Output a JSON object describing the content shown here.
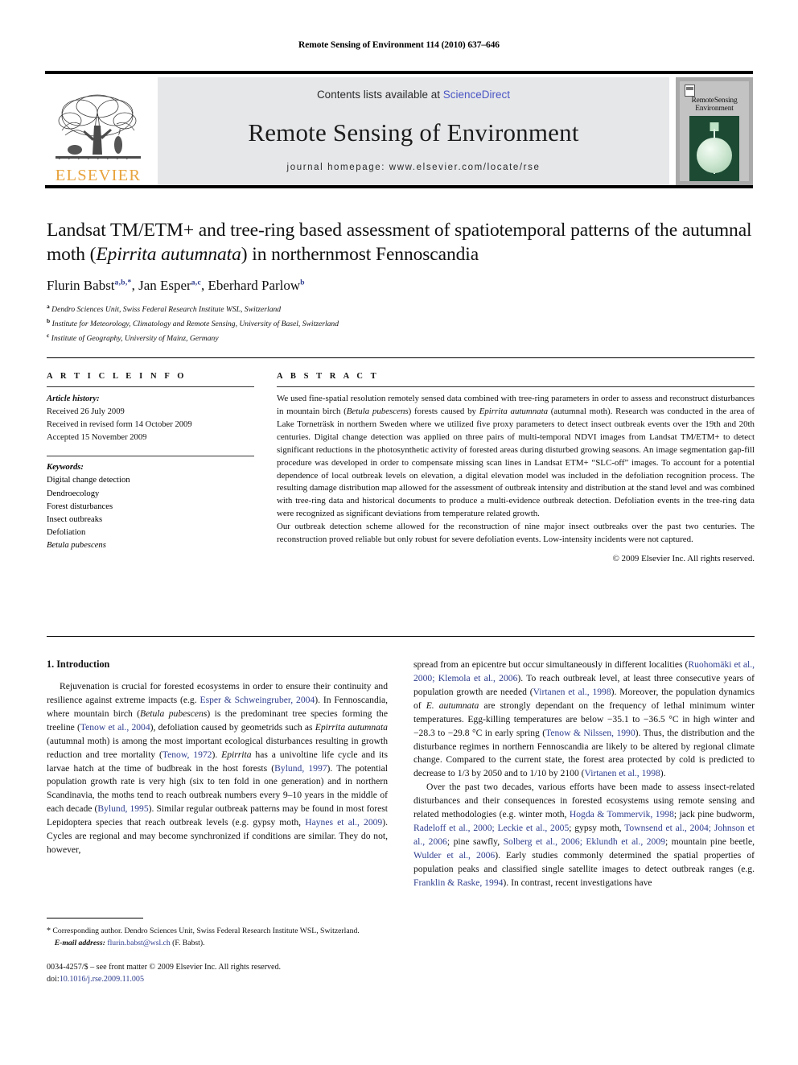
{
  "running_head": "Remote Sensing of Environment 114 (2010) 637–646",
  "masthead": {
    "contents_prefix": "Contents lists available at ",
    "sciencedirect_link": "ScienceDirect",
    "journal_title": "Remote Sensing of Environment",
    "homepage_line": "journal homepage: www.elsevier.com/locate/rse",
    "publisher_wordmark": "ELSEVIER",
    "cover_title_line1": "RemoteSensing",
    "cover_title_line2": "Environment"
  },
  "title": {
    "line1": "Landsat TM/ETM+ and tree-ring based assessment of spatiotemporal patterns of the",
    "line2_pre": "autumnal moth (",
    "line2_italic": "Epirrita autumnata",
    "line2_post": ") in northernmost Fennoscandia",
    "full": "Landsat TM/ETM+ and tree-ring based assessment of spatiotemporal patterns of the autumnal moth (Epirrita autumnata) in northernmost Fennoscandia"
  },
  "authors": {
    "a1_name": "Flurin Babst",
    "a1_sup": "a,b,*",
    "a2_name": "Jan Esper",
    "a2_sup": "a,c",
    "a3_name": "Eberhard Parlow",
    "a3_sup": "b",
    "affiliations": [
      {
        "mark": "a",
        "text": "Dendro Sciences Unit, Swiss Federal Research Institute WSL, Switzerland"
      },
      {
        "mark": "b",
        "text": "Institute for Meteorology, Climatology and Remote Sensing, University of Basel, Switzerland"
      },
      {
        "mark": "c",
        "text": "Institute of Geography, University of Mainz, Germany"
      }
    ]
  },
  "article_info": {
    "heading": "A R T I C L E    I N F O",
    "history_label": "Article history:",
    "history": [
      "Received 26 July 2009",
      "Received in revised form 14 October 2009",
      "Accepted 15 November 2009"
    ],
    "keywords_label": "Keywords:",
    "keywords": [
      "Digital change detection",
      "Dendroecology",
      "Forest disturbances",
      "Insect outbreaks",
      "Defoliation"
    ],
    "keyword_italic": "Betula pubescens"
  },
  "abstract": {
    "heading": "A B S T R A C T",
    "p1_part1": "We used fine-spatial resolution remotely sensed data combined with tree-ring parameters in order to assess and reconstruct disturbances in mountain birch (",
    "p1_italic1": "Betula pubescens",
    "p1_part2": ") forests caused by ",
    "p1_italic2": "Epirrita autumnata",
    "p1_part3": " (autumnal moth). Research was conducted in the area of Lake Torneträsk in northern Sweden where we utilized five proxy parameters to detect insect outbreak events over the 19th and 20th centuries. Digital change detection was applied on three pairs of multi-temporal NDVI images from Landsat TM/ETM+ to detect significant reductions in the photosynthetic activity of forested areas during disturbed growing seasons. An image segmentation gap-fill procedure was developed in order to compensate missing scan lines in Landsat ETM+ “SLC-off” images. To account for a potential dependence of local outbreak levels on elevation, a digital elevation model was included in the defoliation recognition process. The resulting damage distribution map allowed for the assessment of outbreak intensity and distribution at the stand level and was combined with tree-ring data and historical documents to produce a multi-evidence outbreak detection. Defoliation events in the tree-ring data were recognized as significant deviations from temperature related growth.",
    "p2": "Our outbreak detection scheme allowed for the reconstruction of nine major insect outbreaks over the past two centuries. The reconstruction proved reliable but only robust for severe defoliation events. Low-intensity incidents were not captured.",
    "copyright": "© 2009 Elsevier Inc. All rights reserved."
  },
  "introduction": {
    "heading": "1. Introduction",
    "left_p1": "Rejuvenation is crucial for forested ecosystems in order to ensure their continuity and resilience against extreme impacts (e.g. [[Esper & Schweingruber, 2004]]). In Fennoscandia, where mountain birch (<<Betula pubescens>>) is the predominant tree species forming the treeline ([[Tenow et al., 2004]]), defoliation caused by geometrids such as <<Epirrita autumnata>> (autumnal moth) is among the most important ecological disturbances resulting in growth reduction and tree mortality ([[Tenow, 1972]]). <<Epirrita>> has a univoltine life cycle and its larvae hatch at the time of budbreak in the host forests ([[Bylund, 1997]]). The potential population growth rate is very high (six to ten fold in one generation) and in northern Scandinavia, the moths tend to reach outbreak numbers every 9–10 years in the middle of each decade ([[Bylund, 1995]]). Similar regular outbreak patterns may be found in most forest Lepidoptera species that reach outbreak levels (e.g. gypsy moth, [[Haynes et al., 2009]]). Cycles are regional and may become synchronized if conditions are similar. They do not, however,",
    "right_p1": "spread from an epicentre but occur simultaneously in different localities ([[Ruohomäki et al., 2000; Klemola et al., 2006]]). To reach outbreak level, at least three consecutive years of population growth are needed ([[Virtanen et al., 1998]]). Moreover, the population dynamics of <<E. autumnata>> are strongly dependant on the frequency of lethal minimum winter temperatures. Egg-killing temperatures are below −35.1 to −36.5 °C in high winter and −28.3 to −29.8 °C in early spring ([[Tenow & Nilssen, 1990]]). Thus, the distribution and the disturbance regimes in northern Fennoscandia are likely to be altered by regional climate change. Compared to the current state, the forest area protected by cold is predicted to decrease to 1/3 by 2050 and to 1/10 by 2100 ([[Virtanen et al., 1998]]).",
    "right_p2": "Over the past two decades, various efforts have been made to assess insect-related disturbances and their consequences in forested ecosystems using remote sensing and related methodologies (e.g. winter moth, [[Hogda & Tommervik, 1998]]; jack pine budworm, [[Radeloff et al., 2000; Leckie et al., 2005]]; gypsy moth, [[Townsend et al., 2004; Johnson et al., 2006]]; pine sawfly, [[Solberg et al., 2006; Eklundh et al., 2009]]; mountain pine beetle, [[Wulder et al., 2006]]). Early studies commonly determined the spatial properties of population peaks and classified single satellite images to detect outbreak ranges (e.g. [[Franklin & Raske, 1994]]). In contrast, recent investigations have"
  },
  "footnote": {
    "star": "*",
    "text": " Corresponding author. Dendro Sciences Unit, Swiss Federal Research Institute WSL, Switzerland.",
    "email_label": "E-mail address:",
    "email": "flurin.babst@wsl.ch",
    "email_suffix": " (F. Babst)."
  },
  "imprint": {
    "line1": "0034-4257/$ – see front matter © 2009 Elsevier Inc. All rights reserved.",
    "doi_label": "doi:",
    "doi": "10.1016/j.rse.2009.11.005"
  },
  "colors": {
    "link_blue": "#2f3e8f",
    "sciencedirect_blue": "#4a56c4",
    "elsevier_orange": "#E8A33D",
    "band_gray": "#e6e7e9",
    "cover_green": "#1c4a33"
  }
}
